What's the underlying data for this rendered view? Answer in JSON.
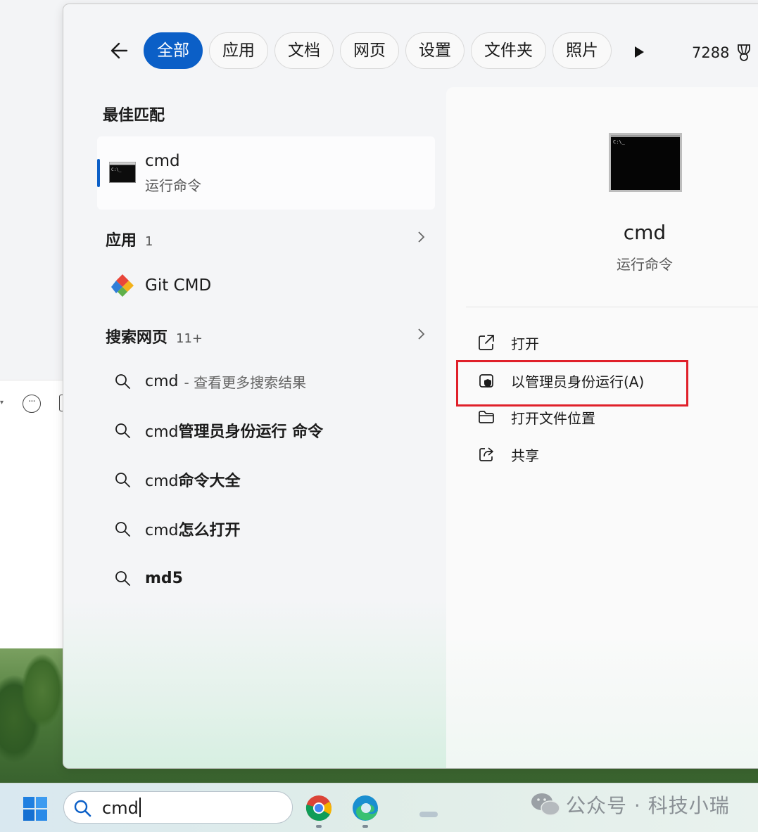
{
  "filters": {
    "chips": [
      {
        "label": "全部",
        "active": true
      },
      {
        "label": "应用",
        "active": false
      },
      {
        "label": "文档",
        "active": false
      },
      {
        "label": "网页",
        "active": false
      },
      {
        "label": "设置",
        "active": false
      },
      {
        "label": "文件夹",
        "active": false
      },
      {
        "label": "照片",
        "active": false
      }
    ],
    "points": "7288"
  },
  "best_match": {
    "heading": "最佳匹配",
    "title": "cmd",
    "subtitle": "运行命令"
  },
  "apps": {
    "heading": "应用",
    "count": "1",
    "item": "Git CMD"
  },
  "web": {
    "heading": "搜索网页",
    "count": "11+",
    "items": [
      {
        "prefix": "cmd",
        "bold": "",
        "hint": "- 查看更多搜索结果"
      },
      {
        "prefix": "cmd",
        "bold": "管理员身份运行 命令",
        "hint": ""
      },
      {
        "prefix": "cmd",
        "bold": "命令大全",
        "hint": ""
      },
      {
        "prefix": "cmd",
        "bold": "怎么打开",
        "hint": ""
      },
      {
        "prefix": "",
        "bold": "md5",
        "hint": ""
      }
    ]
  },
  "detail": {
    "title": "cmd",
    "subtitle": "运行命令",
    "actions": [
      {
        "label": "打开",
        "icon": "open-external-icon"
      },
      {
        "label": "以管理员身份运行(A)",
        "icon": "shield-admin-icon"
      },
      {
        "label": "打开文件位置",
        "icon": "folder-icon"
      },
      {
        "label": "共享",
        "icon": "share-icon"
      }
    ]
  },
  "taskbar": {
    "search_value": "cmd",
    "apps": [
      "chrome-icon",
      "edge-icon"
    ]
  },
  "watermark": {
    "text": "公众号 · 科技小瑞"
  },
  "colors": {
    "accent": "#0b5fc7",
    "highlight": "#e0202a"
  }
}
